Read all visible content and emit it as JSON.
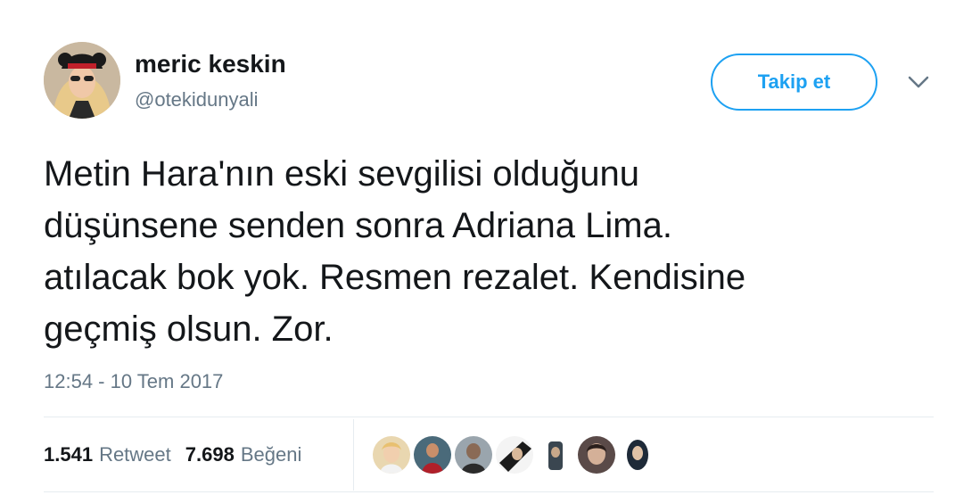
{
  "author": {
    "name": "meric keskin",
    "handle": "@otekidunyali"
  },
  "follow_button": {
    "label": "Takip et"
  },
  "tweet": {
    "text": "Metin Hara'nın eski sevgilisi olduğunu\ndüşünsene senden sonra Adriana Lima.\natılacak bok yok. Resmen rezalet. Kendisine\ngeçmiş olsun. Zor.",
    "timestamp": "12:54 - 10 Tem 2017"
  },
  "stats": {
    "retweets": {
      "count": "1.541",
      "label": "Retweet"
    },
    "likes": {
      "count": "7.698",
      "label": "Beğeni"
    }
  },
  "icons": {
    "menu": "chevron-down-icon"
  },
  "colors": {
    "accent": "#1da1f2",
    "text": "#14171a",
    "muted": "#657786",
    "divider": "#e6ecf0"
  }
}
